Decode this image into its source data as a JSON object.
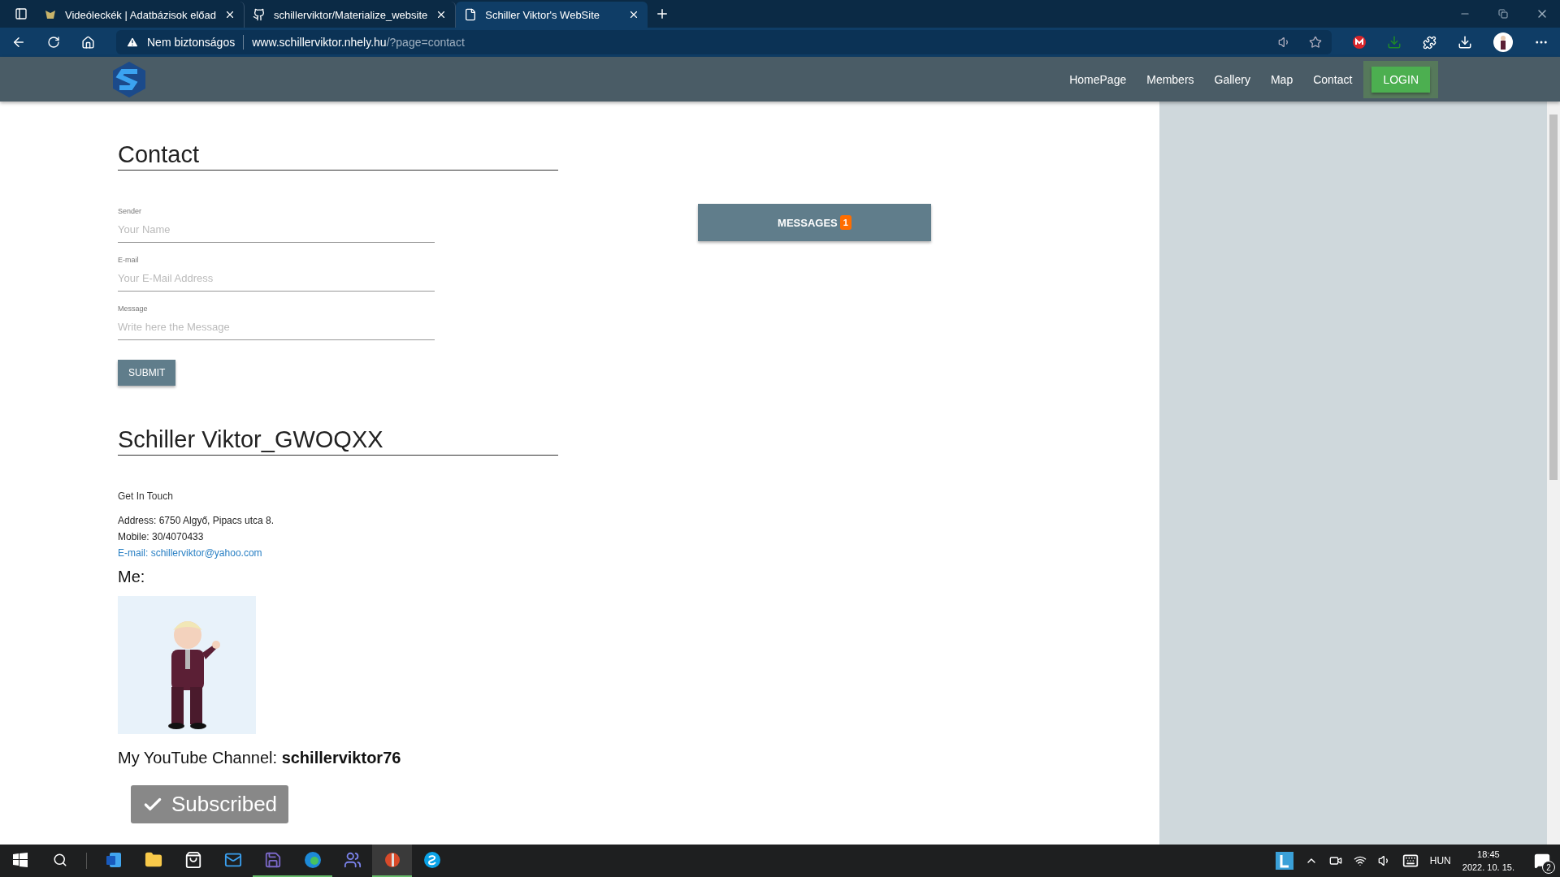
{
  "browser": {
    "tabs": [
      {
        "title": "Videóleckék | Adatbázisok előad",
        "kind": "emblem",
        "selected": false
      },
      {
        "title": "schillerviktor/Materialize_website",
        "kind": "repo",
        "selected": false
      },
      {
        "title": "Schiller Viktor's WebSite",
        "kind": "page",
        "selected": true
      }
    ],
    "security": "Nem biztonságos",
    "url_host": "www.schillerviktor.nhely.hu",
    "url_path": "/?page=contact"
  },
  "nav": {
    "items": [
      "HomePage",
      "Members",
      "Gallery",
      "Map",
      "Contact"
    ],
    "login": "LOGIN"
  },
  "contact": {
    "heading": "Contact",
    "fields": [
      {
        "label": "Sender",
        "placeholder": "Your Name"
      },
      {
        "label": "E-mail",
        "placeholder": "Your E-Mail Address"
      },
      {
        "label": "Message",
        "placeholder": "Write here the Message"
      }
    ],
    "submit": "SUBMIT",
    "messages": {
      "label": "MESSAGES",
      "count": "1"
    }
  },
  "profile": {
    "name": "Schiller Viktor_GWOQXX",
    "intro": "Get In Touch",
    "address": "Address: 6750 Algyő, Pipacs utca 8.",
    "mobile": "Mobile: 30/4070433",
    "email": "E-mail: schillerviktor@yahoo.com",
    "me": "Me:",
    "youtube": "My YouTube Channel: **schillerviktor76**",
    "subscribe": {
      "label": "Subscribed",
      "subscribed": true
    }
  },
  "taskbar": {
    "apps": [
      {
        "kind": "word",
        "running": false,
        "selected": false
      },
      {
        "kind": "folder",
        "running": false,
        "selected": false
      },
      {
        "kind": "store",
        "running": false,
        "selected": false
      },
      {
        "kind": "mail",
        "running": false,
        "selected": false
      },
      {
        "kind": "disk",
        "running": true,
        "selected": false
      },
      {
        "kind": "edge",
        "running": true,
        "selected": false
      },
      {
        "kind": "teams",
        "running": false,
        "selected": false
      },
      {
        "kind": "paint",
        "running": true,
        "selected": true
      },
      {
        "kind": "skype",
        "running": false,
        "selected": false
      }
    ],
    "language": "HUN",
    "time": "18:45",
    "date": "2022. 10. 15.",
    "notifications": "2"
  }
}
